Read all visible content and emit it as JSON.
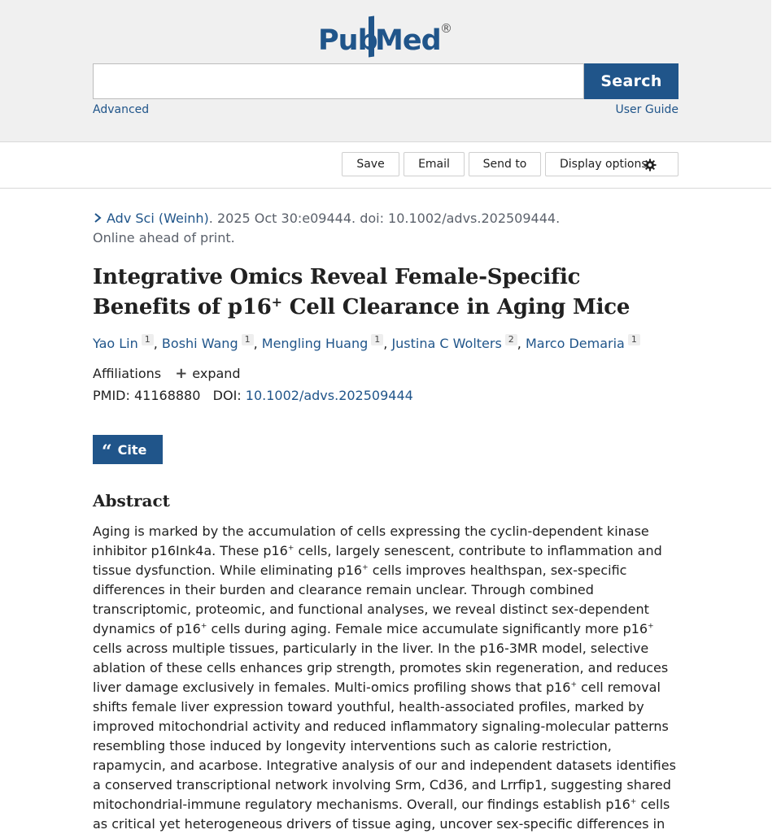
{
  "header": {
    "logo": {
      "pub": "Pub",
      "med": "Med",
      "reg": "®"
    },
    "search": {
      "placeholder": "",
      "button_label": "Search"
    },
    "links": {
      "advanced": "Advanced",
      "user_guide": "User Guide"
    }
  },
  "toolbar": {
    "save": "Save",
    "email": "Email",
    "send_to": "Send to",
    "display_options": "Display options",
    "display_icon": "gear-icon"
  },
  "article": {
    "journal": "Adv Sci (Weinh)",
    "citation_rest": ". 2025 Oct 30:e09444. doi: 10.1002/advs.202509444.",
    "status": "Online ahead of print.",
    "title_part1": "Integrative Omics Reveal Female-Specific Benefits of p16",
    "title_sup": "+",
    "title_part2": " Cell Clearance in Aging Mice",
    "authors": [
      {
        "name": "Yao Lin",
        "aff": "1"
      },
      {
        "name": "Boshi Wang",
        "aff": "1"
      },
      {
        "name": "Mengling Huang",
        "aff": "1"
      },
      {
        "name": "Justina C Wolters",
        "aff": "2"
      },
      {
        "name": "Marco Demaria",
        "aff": "1"
      }
    ],
    "affiliations_label": "Affiliations",
    "expand_label": "expand",
    "pmid_label": "PMID: ",
    "pmid": "41168880",
    "doi_label": "DOI: ",
    "doi": "10.1002/advs.202509444",
    "cite_label": "Cite"
  },
  "abstract": {
    "heading": "Abstract",
    "seg1": "Aging is marked by the accumulation of cells expressing the cyclin-dependent kinase inhibitor p16Ink4a. These p16",
    "seg2": " cells, largely senescent, contribute to inflammation and tissue dysfunction. While eliminating p16",
    "seg3": " cells improves healthspan, sex-specific differences in their burden and clearance remain unclear. Through combined transcriptomic, proteomic, and functional analyses, we reveal distinct sex-dependent dynamics of p16",
    "seg4": " cells during aging. Female mice accumulate significantly more p16",
    "seg5": " cells across multiple tissues, particularly in the liver. In the p16-3MR model, selective ablation of these cells enhances grip strength, promotes skin regeneration, and reduces liver damage exclusively in females. Multi-omics profiling shows that p16",
    "seg6": " cell removal shifts female liver expression toward youthful, health-associated profiles, marked by improved mitochondrial activity and reduced inflammatory signaling-molecular patterns resembling those induced by longevity interventions such as calorie restriction, rapamycin, and acarbose. Integrative analysis of our and independent datasets identifies a conserved transcriptional network involving Srm, Cd36, and Lrrfip1, suggesting shared mitochondrial-immune regulatory mechanisms. Overall, our findings establish p16",
    "seg7": " cells as critical yet heterogeneous drivers of tissue aging, uncover sex-specific differences in",
    "plus": "+"
  }
}
